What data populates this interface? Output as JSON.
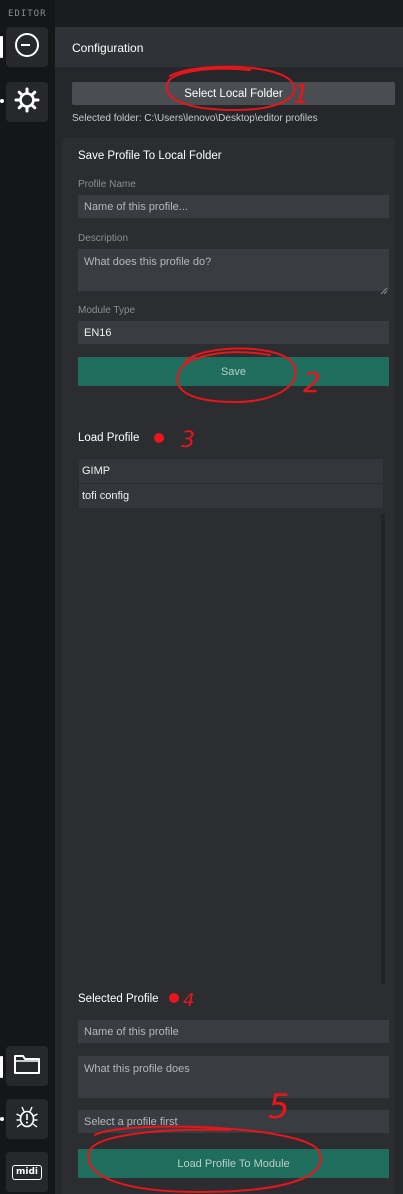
{
  "rail": {
    "title": "EDITOR",
    "top_icons": [
      "logout-circle-icon",
      "gear-icon"
    ],
    "bottom_icons": [
      "folder-icon",
      "bug-icon",
      "midi-icon"
    ],
    "midi_label": "midi"
  },
  "panel": {
    "title": "Configuration",
    "select_folder_label": "Select Local Folder",
    "selected_folder_text": "Selected folder: C:\\Users\\lenovo\\Desktop\\editor profiles"
  },
  "save_section": {
    "title": "Save Profile To Local Folder",
    "profile_name_label": "Profile Name",
    "profile_name_placeholder": "Name of this profile...",
    "description_label": "Description",
    "description_placeholder": "What does this profile do?",
    "module_type_label": "Module Type",
    "module_type_value": "EN16",
    "save_label": "Save"
  },
  "load_section": {
    "title": "Load Profile",
    "profiles": [
      "GIMP",
      "tofi config"
    ]
  },
  "selected_section": {
    "title": "Selected Profile",
    "name_placeholder": "Name of this profile",
    "description_placeholder": "What this profile does",
    "module_placeholder": "Select a profile first",
    "load_button_label": "Load Profile To Module"
  },
  "annotations": {
    "numbers": [
      "1",
      "2",
      "3",
      "4",
      "5"
    ],
    "color": "#e8151b"
  },
  "colors": {
    "accent_teal": "#1f6e5d",
    "panel_bg": "#25272a",
    "input_bg": "#393c40"
  }
}
